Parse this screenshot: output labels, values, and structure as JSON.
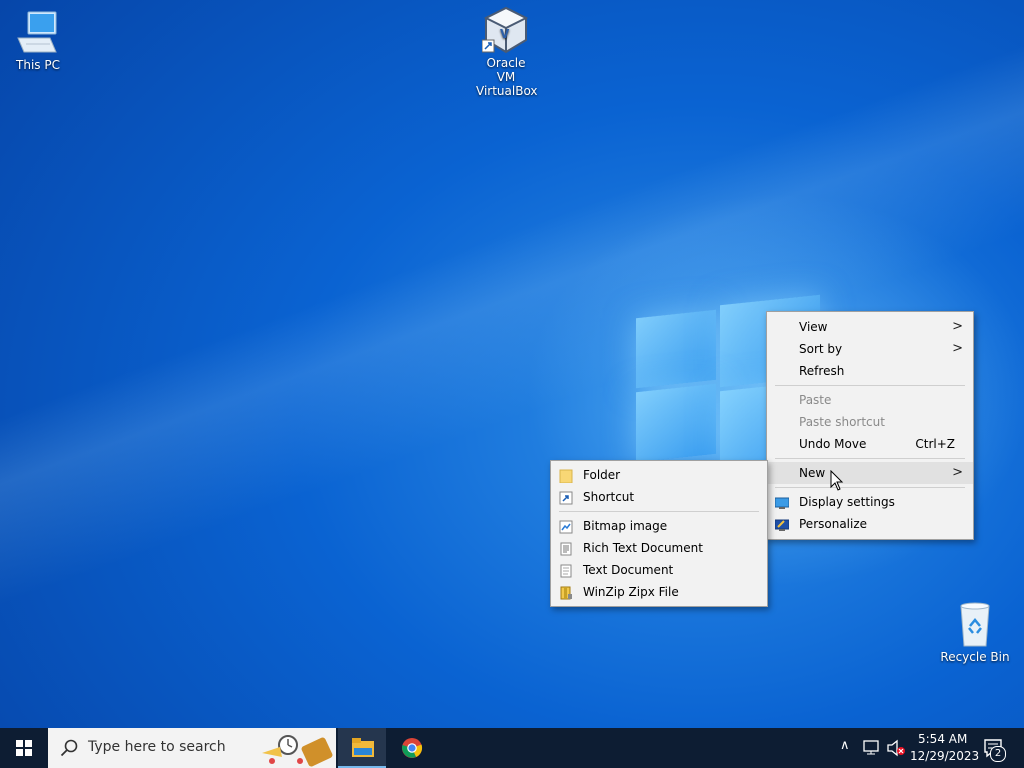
{
  "desktop": {
    "icons": [
      {
        "label": "This PC"
      },
      {
        "label": "Oracle VM VirtualBox"
      },
      {
        "label": "Recycle Bin"
      }
    ]
  },
  "context_menu": {
    "view": "View",
    "sort_by": "Sort by",
    "refresh": "Refresh",
    "paste": "Paste",
    "paste_shortcut": "Paste shortcut",
    "undo_move": "Undo Move",
    "undo_shortcut": "Ctrl+Z",
    "new": "New",
    "display_settings": "Display settings",
    "personalize": "Personalize"
  },
  "new_submenu": {
    "folder": "Folder",
    "shortcut": "Shortcut",
    "bitmap": "Bitmap image",
    "rtf": "Rich Text Document",
    "text": "Text Document",
    "winzip": "WinZip Zipx File"
  },
  "taskbar": {
    "search_placeholder": "Type here to search",
    "time": "5:54 AM",
    "date": "12/29/2023",
    "notification_count": "2"
  },
  "colors": {
    "taskbar": "#0d1d33",
    "menu_bg": "#f2f2f2",
    "accent": "#0a63d2"
  }
}
